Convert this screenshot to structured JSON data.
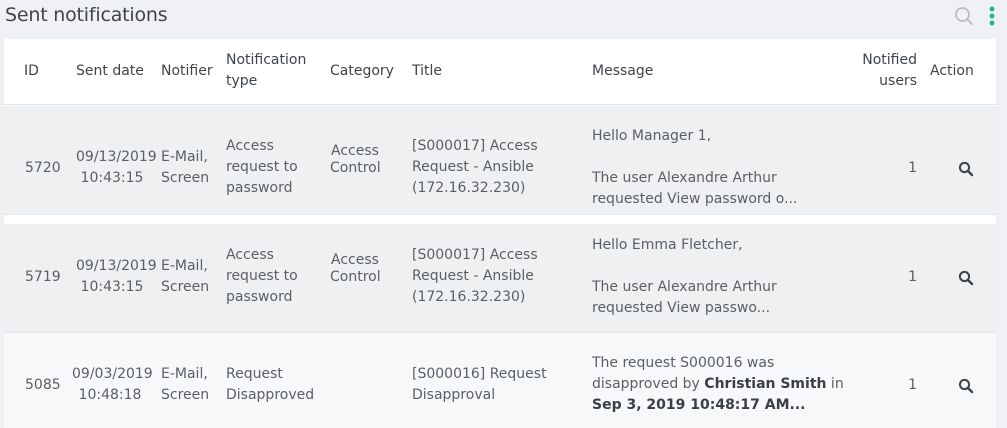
{
  "header": {
    "title": "Sent notifications",
    "search_icon": "search-icon",
    "menu_icon": "kebab-menu-icon"
  },
  "colors": {
    "accent": "#1fb57a",
    "row_shaded": "#eef0f2",
    "row_light": "#f7f8f9"
  },
  "table": {
    "columns": {
      "id": "ID",
      "sent_date": "Sent date",
      "notifier": "Notifier",
      "notification_type_1": "Notification",
      "notification_type_2": "type",
      "category": "Category",
      "title": "Title",
      "message": "Message",
      "notified_users_1": "Notified",
      "notified_users_2": "users",
      "action": "Action"
    },
    "rows": [
      {
        "id": "5720",
        "date": "09/13/2019",
        "time": "10:43:15",
        "notifier_1": "E-Mail,",
        "notifier_2": "Screen",
        "type_1": "Access",
        "type_2": "request to",
        "type_3": "password",
        "category_1": "Access",
        "category_2": "Control",
        "title_1": "[S000017] Access",
        "title_2": "Request - Ansible",
        "title_3": "(172.16.32.230)",
        "message_1": "Hello Manager 1,",
        "message_2": "The user Alexandre Arthur",
        "message_3": "requested View password o...",
        "notified_users": "1"
      },
      {
        "id": "5719",
        "date": "09/13/2019",
        "time": "10:43:15",
        "notifier_1": "E-Mail,",
        "notifier_2": "Screen",
        "type_1": "Access",
        "type_2": "request to",
        "type_3": "password",
        "category_1": "Access",
        "category_2": "Control",
        "title_1": "[S000017] Access",
        "title_2": "Request - Ansible",
        "title_3": "(172.16.32.230)",
        "message_1": "Hello Emma Fletcher,",
        "message_2": "The user Alexandre Arthur",
        "message_3": "requested View passwo...",
        "notified_users": "1"
      },
      {
        "id": "5085",
        "date": "09/03/2019",
        "time": "10:48:18",
        "notifier_1": "E-Mail,",
        "notifier_2": "Screen",
        "type_1": "Request",
        "type_2": "Disapproved",
        "category_1": "",
        "category_2": "",
        "title_1": "[S000016] Request",
        "title_2": "Disapproval",
        "message_1": "The request S000016 was",
        "message_2a": "disapproved by ",
        "message_2b": "Christian Smith",
        "message_2c": " in",
        "message_3": "Sep 3, 2019 10:48:17 AM...",
        "notified_users": "1"
      }
    ]
  }
}
